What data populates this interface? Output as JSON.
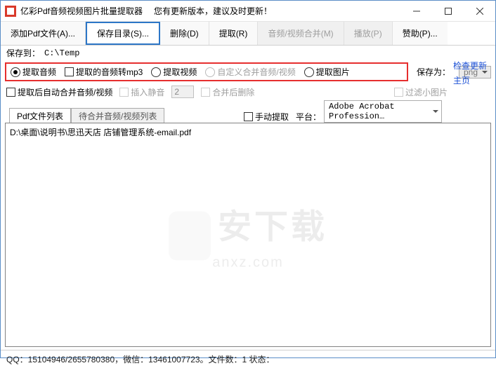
{
  "titlebar": {
    "app_name": "亿彩Pdf音频视频图片批量提取器",
    "update_notice": "您有更新版本，建议及时更新！"
  },
  "toolbar": {
    "add": "添加Pdf文件(A)...",
    "save_dir": "保存目录(S)...",
    "delete": "删除(D)",
    "extract": "提取(R)",
    "merge": "音频/视频合并(M)",
    "play": "播放(P)",
    "donate": "赞助(P)..."
  },
  "save_to": {
    "label": "保存到：",
    "path": "C:\\Temp"
  },
  "options": {
    "extract_audio": "提取音频",
    "audio_to_mp3": "提取的音频转mp3",
    "extract_video": "提取视频",
    "custom_merge": "自定义合并音频/视频",
    "extract_image": "提取图片",
    "save_as_label": "保存为：",
    "save_as_value": "png"
  },
  "row2": {
    "auto_merge": "提取后自动合并音频/视频",
    "insert_silence": "插入静音",
    "silence_value": "2",
    "delete_after_merge": "合并后删除",
    "filter_small": "过滤小图片"
  },
  "row3": {
    "manual_extract": "手动提取",
    "platform_label": "平台：",
    "platform_value": "Adobe Acrobat Profession…"
  },
  "tabs": {
    "file_list": "Pdf文件列表",
    "merge_list": "待合并音频/视频列表"
  },
  "list": {
    "item0": "D:\\桌面\\说明书\\思迅天店 店铺管理系统-email.pdf"
  },
  "links": {
    "check_update": "检查更新",
    "homepage": "主页"
  },
  "statusbar": {
    "text": "QQ：15104946/2655780380，微信：13461007723。文件数：1  状态："
  },
  "watermark": {
    "main": "安下载",
    "sub": "anxz.com"
  }
}
